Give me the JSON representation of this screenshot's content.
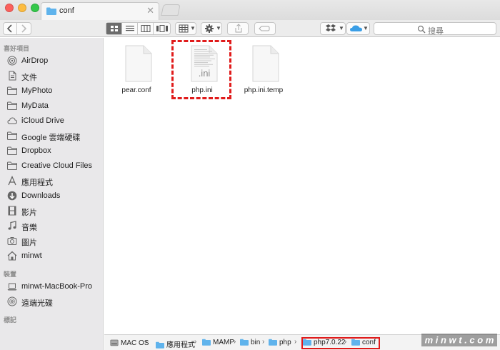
{
  "window": {
    "tab_title": "conf",
    "tab_close": "✕"
  },
  "toolbar": {
    "search_placeholder": "搜尋"
  },
  "sidebar": {
    "favorites_header": "喜好項目",
    "favorites": [
      {
        "label": "AirDrop",
        "icon": "airdrop-icon"
      },
      {
        "label": "文件",
        "icon": "documents-icon"
      },
      {
        "label": "MyPhoto",
        "icon": "folder-icon"
      },
      {
        "label": "MyData",
        "icon": "folder-icon"
      },
      {
        "label": "iCloud Drive",
        "icon": "cloud-icon"
      },
      {
        "label": "Google 雲端硬碟",
        "icon": "folder-icon"
      },
      {
        "label": "Dropbox",
        "icon": "folder-icon"
      },
      {
        "label": "Creative Cloud Files",
        "icon": "folder-icon"
      },
      {
        "label": "應用程式",
        "icon": "applications-icon"
      },
      {
        "label": "Downloads",
        "icon": "downloads-icon"
      },
      {
        "label": "影片",
        "icon": "movies-icon"
      },
      {
        "label": "音樂",
        "icon": "music-icon"
      },
      {
        "label": "圖片",
        "icon": "pictures-icon"
      },
      {
        "label": "minwt",
        "icon": "home-icon"
      }
    ],
    "devices_header": "裝置",
    "devices": [
      {
        "label": "minwt-MacBook-Pro",
        "icon": "laptop-icon"
      },
      {
        "label": "遠端光碟",
        "icon": "disc-icon"
      }
    ],
    "tags_header": "標記"
  },
  "files": [
    {
      "name": "pear.conf",
      "icon": "document-icon"
    },
    {
      "name": "php.ini",
      "icon": "ini-document-icon",
      "badge": ".ini",
      "highlighted": true
    },
    {
      "name": "php.ini.temp",
      "icon": "document-icon"
    }
  ],
  "path": [
    {
      "label": "MAC OS",
      "icon": "disk-icon"
    },
    {
      "label": "應用程式",
      "icon": "folder-icon"
    },
    {
      "label": "MAMP",
      "icon": "folder-icon"
    },
    {
      "label": "bin",
      "icon": "folder-icon"
    },
    {
      "label": "php",
      "icon": "folder-icon"
    },
    {
      "label": "php7.0.22",
      "icon": "folder-icon"
    },
    {
      "label": "conf",
      "icon": "folder-icon"
    }
  ],
  "path_separator": "›",
  "colors": {
    "highlight": "#e01b1b",
    "folder": "#5fb3ec",
    "sidebar_bg": "#e9e8ea"
  },
  "watermark": {
    "text": "minwt"
  }
}
